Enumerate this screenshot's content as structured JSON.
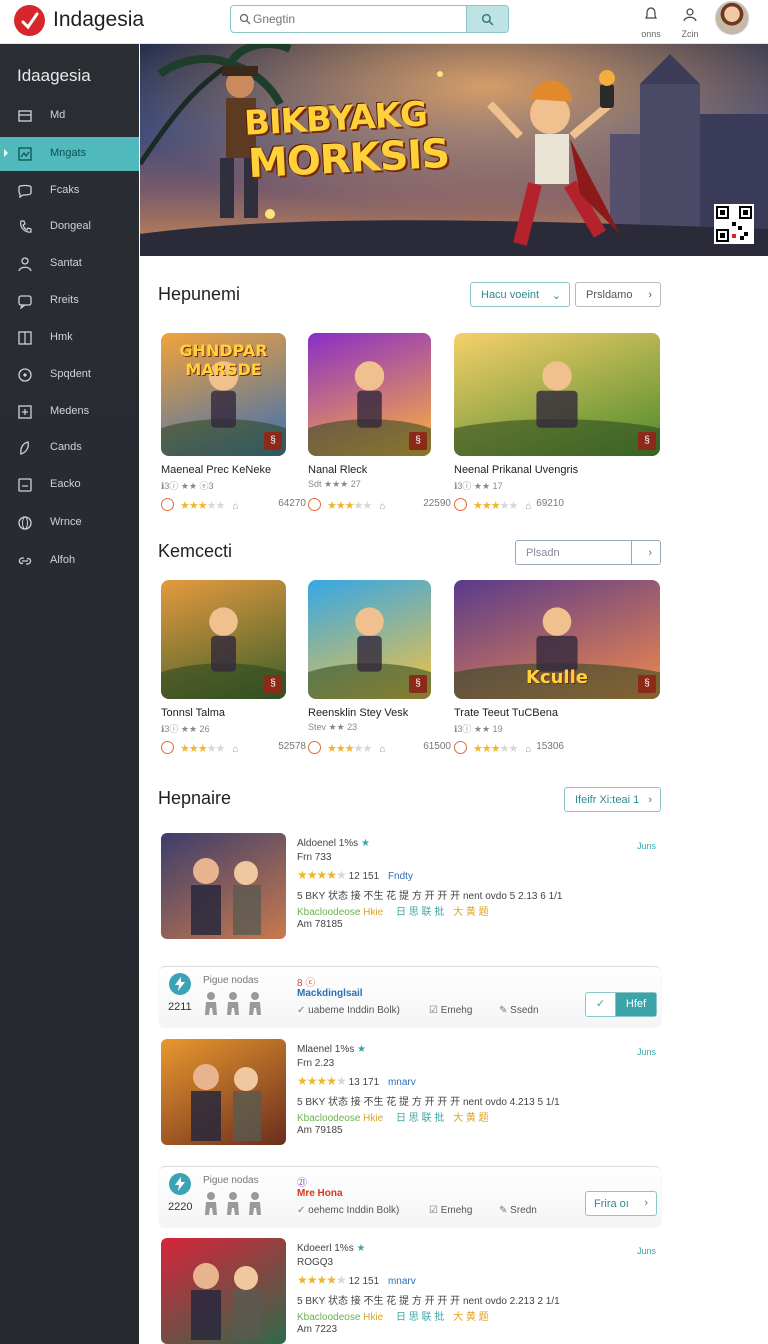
{
  "header": {
    "app_title": "Indagesia",
    "search_placeholder": "Gnegtin",
    "icons": [
      {
        "name": "notifications-icon",
        "label": "onns"
      },
      {
        "name": "profile-icon",
        "label": "Zcin"
      }
    ]
  },
  "sidebar": {
    "title": "Idaagesia",
    "items": [
      {
        "label": "Md",
        "icon": "window-icon",
        "active": false
      },
      {
        "label": "Mngats",
        "icon": "image-icon",
        "active": true
      },
      {
        "label": "Fcaks",
        "icon": "chat-icon",
        "active": false
      },
      {
        "label": "Dongeal",
        "icon": "phone-icon",
        "active": false
      },
      {
        "label": "Santat",
        "icon": "user-icon",
        "active": false
      },
      {
        "label": "Rreits",
        "icon": "message-icon",
        "active": false
      },
      {
        "label": "Hmk",
        "icon": "grid-icon",
        "active": false
      },
      {
        "label": "Spqdent",
        "icon": "target-icon",
        "active": false
      },
      {
        "label": "Medens",
        "icon": "expand-icon",
        "active": false
      },
      {
        "label": "Cands",
        "icon": "leaf-icon",
        "active": false
      },
      {
        "label": "Eacko",
        "icon": "box-icon",
        "active": false
      },
      {
        "label": "Wrnce",
        "icon": "globe-icon",
        "active": false
      },
      {
        "label": "Alfoh",
        "icon": "link-icon",
        "active": false
      }
    ]
  },
  "hero": {
    "title_line1": "BIKBYAKG",
    "title_line2": "MORKSIS"
  },
  "section1": {
    "title": "Hepunemi",
    "filter_label": "Hacu voeint",
    "more_label": "Prsldamo",
    "cards": [
      {
        "name": "Maeneal Prec KeNeke",
        "sub": "ℹ3ⓘ ★★ ⓔ3",
        "count": "64270",
        "rating": 3,
        "art": "GHNDPAR MARSDE"
      },
      {
        "name": "Nanal Rleck",
        "sub": "Sdt ★★★ 27",
        "count": "22590",
        "rating": 3,
        "art": ""
      },
      {
        "name": "Neenal Prikanal Uvengris",
        "sub": "ℹ3ⓘ ★★ 17",
        "count": "69210",
        "rating": 3,
        "art": ""
      }
    ]
  },
  "section2": {
    "title": "Kemcecti",
    "filter_placeholder": "Plsadn",
    "cards": [
      {
        "name": "Tonnsl Talma",
        "sub": "ℹ3ⓘ ★★ 26",
        "count": "52578",
        "rating": 3,
        "art": ""
      },
      {
        "name": "Reensklin Stey Vesk",
        "sub": "Stev ★★ 23",
        "count": "61500",
        "rating": 3,
        "art": ""
      },
      {
        "name": "Trate Teeut TuCBena",
        "sub": "ℹ3ⓘ ★★ 19",
        "count": "15306",
        "rating": 3,
        "art": "Kculle"
      }
    ]
  },
  "section3": {
    "title": "Hepnaire",
    "more_label": "Ifeifr Xi:teai 1",
    "entries": [
      {
        "title": "Aldoenel 1%s",
        "line2": "Frn 733",
        "rating_text": "12 151",
        "rating_link": "Fndty",
        "desc": "5 BKY 状态 接 不生 花 提 方 开 开 开 nent ovdo 5 2.13 6 1/1",
        "tags": [
          "Kbacloodeose",
          "Hkie",
          "日 思 联 批",
          "大 黄 题"
        ],
        "footer": "Am  78185",
        "date": "Juns"
      },
      {
        "title": "Mlaenel 1%s",
        "line2": "Frn 2.23",
        "rating_text": "13 171",
        "rating_link": "mnarv",
        "desc": "5 BKY 状态 接 不生 花 提 方 开 开 开 nent ovdo 4.213 5 1/1",
        "tags": [
          "Kbacloodeose",
          "Hkie",
          "日 思 联 批",
          "大 黄 题"
        ],
        "footer": "Am  79185",
        "date": "Juns"
      },
      {
        "title": "Kdoeerl 1%s",
        "line2": "ROGQ3",
        "rating_text": "12 151",
        "rating_link": "mnarv",
        "desc": "5 BKY 状态 接 不生 花 提 方 开 开 开 nent ovdo 2.213 2 1/1",
        "tags": [
          "Kbacloodeose",
          "Hkie",
          "日 思 联 批",
          "大 黄 题"
        ],
        "footer": "Am  7223",
        "date": "Juns"
      }
    ],
    "info_boxes": [
      {
        "num": "2211",
        "label": "Pigue nodas",
        "mid": "8 ⓒ",
        "mid_link": "Mackdinglsail",
        "opt1": "uabeme Inddin Bolk)",
        "opt2": "Emehg",
        "opt3": "Ssedn",
        "action": "Hfef",
        "action_style": "filled"
      },
      {
        "num": "2220",
        "label": "Pigue nodas",
        "mid": "㉑",
        "mid_link": "Mre  Hona",
        "opt1": "oehemc Inddin Bolk)",
        "opt2": "Emehg",
        "opt3": "Sredn",
        "action": "Frira oı",
        "action_style": "outline"
      }
    ]
  },
  "colors": {
    "accent": "#4fb9bc",
    "brand_red": "#d8262d",
    "star": "#f1b52b",
    "sidebar_bg": "#2a2e33"
  }
}
